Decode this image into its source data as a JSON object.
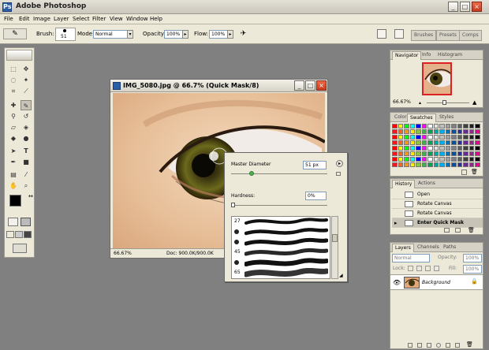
{
  "app": {
    "title": "Adobe Photoshop",
    "icon_name": "photoshop-icon",
    "icon_letter": "Ps"
  },
  "window_controls": {
    "minimize": "_",
    "maximize": "□",
    "close": "×"
  },
  "menu": [
    "File",
    "Edit",
    "Image",
    "Layer",
    "Select",
    "Filter",
    "View",
    "Window",
    "Help"
  ],
  "options": {
    "brush_label": "Brush:",
    "brush_size": "51",
    "mode_label": "Mode:",
    "mode_value": "Normal",
    "opacity_label": "Opacity:",
    "opacity_value": "100%",
    "flow_label": "Flow:",
    "flow_value": "100%",
    "well_tabs": [
      "Brushes",
      "Presets",
      "Comps"
    ]
  },
  "document": {
    "title": "IMG_5080.jpg @ 66.7% (Quick Mask/8)",
    "zoom": "66.67%",
    "doc_info": "Doc: 900.0K/900.0K"
  },
  "brush_picker": {
    "master_diameter_label": "Master Diameter",
    "master_diameter_value": "51 px",
    "master_diameter_fraction": 0.2,
    "hardness_label": "Hardness:",
    "hardness_value": "0%",
    "hardness_fraction": 0.0,
    "brushes": [
      {
        "label": "27"
      },
      {
        "label": ""
      },
      {
        "label": ""
      },
      {
        "label": "45"
      },
      {
        "label": ""
      },
      {
        "label": "65"
      }
    ]
  },
  "navigator": {
    "tabs": [
      "Navigator",
      "Info",
      "Histogram"
    ],
    "zoom": "66.67%"
  },
  "color_panel": {
    "tabs": [
      "Color",
      "Swatches",
      "Styles"
    ]
  },
  "history": {
    "tabs": [
      "History",
      "Actions"
    ],
    "items": [
      "Open",
      "Rotate Canvas",
      "Rotate Canvas",
      "Enter Quick Mask"
    ],
    "selected_index": 3
  },
  "layers": {
    "tabs": [
      "Layers",
      "Channels",
      "Paths"
    ],
    "blend_mode": "Normal",
    "opacity_label": "Opacity:",
    "opacity_value": "100%",
    "lock_label": "Lock:",
    "fill_label": "Fill:",
    "fill_value": "100%",
    "layer_name": "Background"
  },
  "colors": {
    "swatches": [
      "#ff0000",
      "#ffff00",
      "#00ff00",
      "#00ffff",
      "#0000ff",
      "#ff00ff",
      "#ffffff",
      "#e0e0e0",
      "#c0c0c0",
      "#a0a0a0",
      "#808080",
      "#606060",
      "#404040",
      "#202020",
      "#000000",
      "#ed1c24",
      "#f26522",
      "#f7941d",
      "#fff200",
      "#8dc63f",
      "#39b54a",
      "#00a651",
      "#00a99d",
      "#00aeef",
      "#0072bc",
      "#0054a6",
      "#2e3192",
      "#662d91",
      "#92278f",
      "#ec008c"
    ]
  }
}
